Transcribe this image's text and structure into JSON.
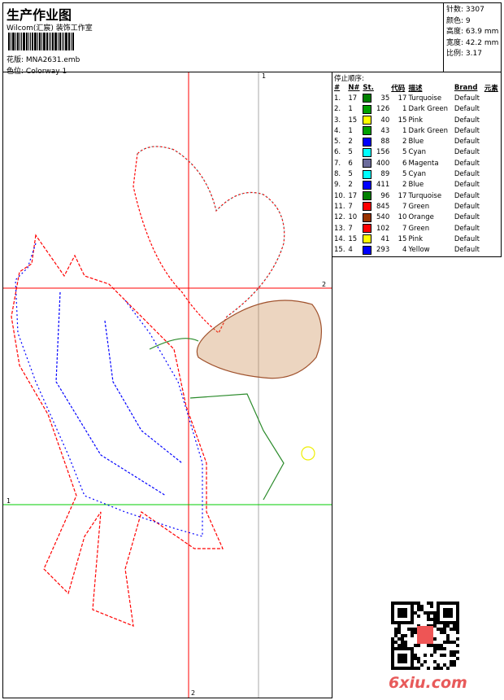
{
  "header": {
    "title": "生产作业图",
    "company": "Wilcom(汇宸) 装饰工作室",
    "design_label": "花版:",
    "design_value": "MNA2631.emb",
    "colorway_label": "色位:",
    "colorway_value": "Colorway 1"
  },
  "stats": [
    {
      "label": "针数:",
      "value": "3307"
    },
    {
      "label": "颜色:",
      "value": "9"
    },
    {
      "label": "高度:",
      "value": "63.9 mm"
    },
    {
      "label": "宽度:",
      "value": "42.2 mm"
    },
    {
      "label": "比例:",
      "value": "3.17"
    }
  ],
  "stop_sequence": {
    "title": "停止顺序:",
    "columns": [
      "#",
      "N#",
      "St.",
      "代码",
      "描述",
      "Brand",
      "元素"
    ],
    "rows": [
      {
        "n": "1.",
        "needle": "17",
        "color": "#008000",
        "st": "35",
        "code": "17",
        "desc": "Turquoise",
        "brand": "Default"
      },
      {
        "n": "2.",
        "needle": "1",
        "color": "#00a000",
        "st": "126",
        "code": "1",
        "desc": "Dark Green",
        "brand": "Default"
      },
      {
        "n": "3.",
        "needle": "15",
        "color": "#ffff00",
        "st": "40",
        "code": "15",
        "desc": "Pink",
        "brand": "Default"
      },
      {
        "n": "4.",
        "needle": "1",
        "color": "#00a000",
        "st": "43",
        "code": "1",
        "desc": "Dark Green",
        "brand": "Default"
      },
      {
        "n": "5.",
        "needle": "2",
        "color": "#0000ff",
        "st": "88",
        "code": "2",
        "desc": "Blue",
        "brand": "Default"
      },
      {
        "n": "6.",
        "needle": "5",
        "color": "#00ffff",
        "st": "156",
        "code": "5",
        "desc": "Cyan",
        "brand": "Default"
      },
      {
        "n": "7.",
        "needle": "6",
        "color": "#6c6c9c",
        "st": "400",
        "code": "6",
        "desc": "Magenta",
        "brand": "Default"
      },
      {
        "n": "8.",
        "needle": "5",
        "color": "#00ffff",
        "st": "89",
        "code": "5",
        "desc": "Cyan",
        "brand": "Default"
      },
      {
        "n": "9.",
        "needle": "2",
        "color": "#0000ff",
        "st": "411",
        "code": "2",
        "desc": "Blue",
        "brand": "Default"
      },
      {
        "n": "10.",
        "needle": "17",
        "color": "#008000",
        "st": "96",
        "code": "17",
        "desc": "Turquoise",
        "brand": "Default"
      },
      {
        "n": "11.",
        "needle": "7",
        "color": "#ff0000",
        "st": "845",
        "code": "7",
        "desc": "Green",
        "brand": "Default"
      },
      {
        "n": "12.",
        "needle": "10",
        "color": "#993300",
        "st": "540",
        "code": "10",
        "desc": "Orange",
        "brand": "Default"
      },
      {
        "n": "13.",
        "needle": "7",
        "color": "#ff0000",
        "st": "102",
        "code": "7",
        "desc": "Green",
        "brand": "Default"
      },
      {
        "n": "14.",
        "needle": "15",
        "color": "#ffff00",
        "st": "41",
        "code": "15",
        "desc": "Pink",
        "brand": "Default"
      },
      {
        "n": "15.",
        "needle": "4",
        "color": "#0000ff",
        "st": "293",
        "code": "4",
        "desc": "Yellow",
        "brand": "Default"
      }
    ]
  },
  "axes": {
    "v1": "1",
    "h2": "2",
    "h1": "1",
    "v2": "2"
  },
  "watermark": "6xiu.com"
}
